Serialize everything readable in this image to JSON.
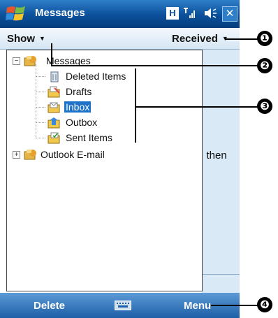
{
  "titlebar": {
    "app_title": "Messages",
    "tray_h": "H",
    "close_glyph": "✕"
  },
  "menubar": {
    "show_label": "Show",
    "received_label": "Received",
    "caret": "▼"
  },
  "tree": {
    "root_label": "Messages",
    "children": [
      {
        "label": "Deleted Items",
        "icon": "deleted-items-icon"
      },
      {
        "label": "Drafts",
        "icon": "drafts-folder-icon"
      },
      {
        "label": "Inbox",
        "icon": "inbox-folder-icon",
        "selected": true
      },
      {
        "label": "Outbox",
        "icon": "outbox-folder-icon"
      },
      {
        "label": "Sent Items",
        "icon": "sent-items-icon"
      }
    ],
    "second_root_label": "Outlook E-mail",
    "collapse_glyph": "−",
    "expand_glyph": "+"
  },
  "listpane": {
    "visible_text": "ı, then"
  },
  "softkeys": {
    "left": "Delete",
    "right": "Menu"
  },
  "callouts": [
    "❶",
    "❷",
    "❸",
    "❹"
  ],
  "colors": {
    "titlebar": "#0b4f9a",
    "selection": "#1e73c8",
    "softbar": "#2a6bb2"
  }
}
